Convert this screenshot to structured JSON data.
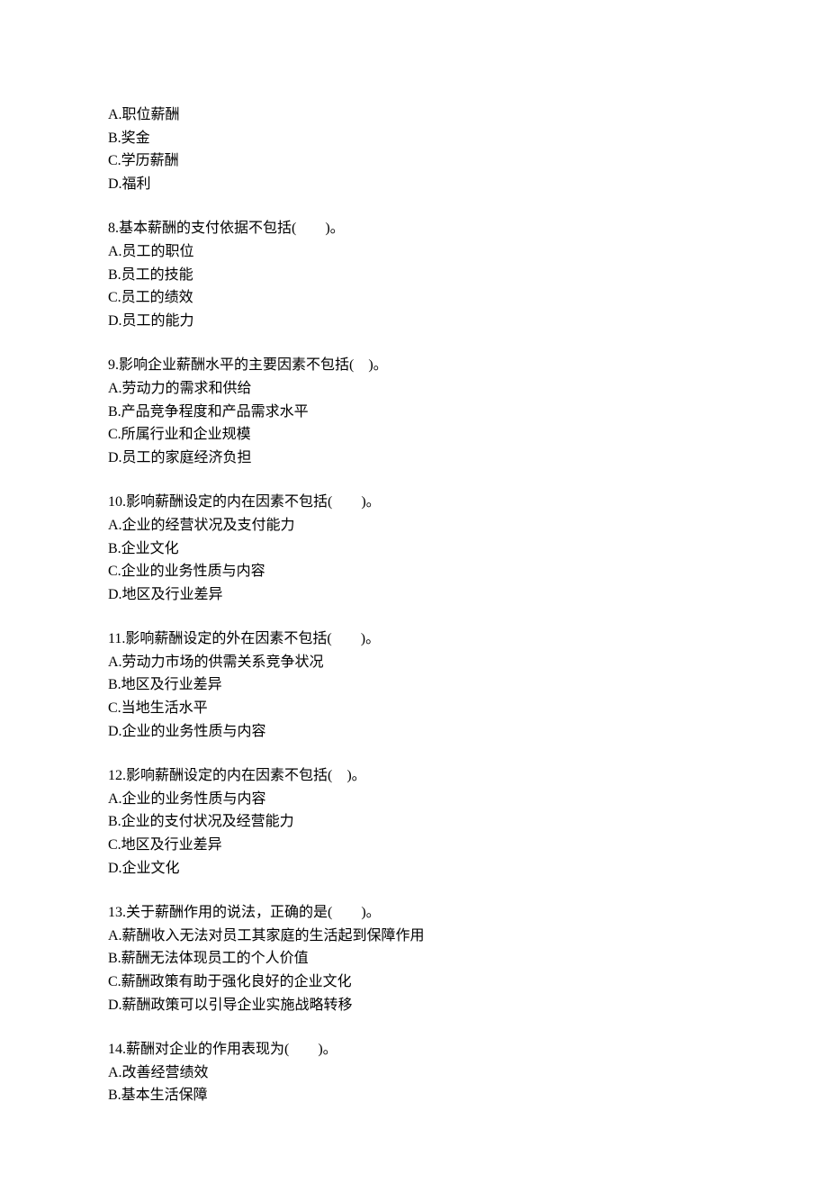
{
  "q7": {
    "options": {
      "A": "A.职位薪酬",
      "B": "B.奖金",
      "C": "C.学历薪酬",
      "D": "D.福利"
    }
  },
  "q8": {
    "stem": "8.基本薪酬的支付依据不包括(　　)。",
    "options": {
      "A": "A.员工的职位",
      "B": "B.员工的技能",
      "C": "C.员工的绩效",
      "D": "D.员工的能力"
    }
  },
  "q9": {
    "stem": "9.影响企业薪酬水平的主要因素不包括(　)。",
    "options": {
      "A": "A.劳动力的需求和供给",
      "B": "B.产品竞争程度和产品需求水平",
      "C": "C.所属行业和企业规模",
      "D": "D.员工的家庭经济负担"
    }
  },
  "q10": {
    "stem": "10.影响薪酬设定的内在因素不包括(　　)。",
    "options": {
      "A": "A.企业的经营状况及支付能力",
      "B": "B.企业文化",
      "C": "C.企业的业务性质与内容",
      "D": "D.地区及行业差异"
    }
  },
  "q11": {
    "stem": "11.影响薪酬设定的外在因素不包括(　　)。",
    "options": {
      "A": "A.劳动力市场的供需关系竞争状况",
      "B": "B.地区及行业差异",
      "C": "C.当地生活水平",
      "D": "D.企业的业务性质与内容"
    }
  },
  "q12": {
    "stem": "12.影响薪酬设定的内在因素不包括(　)。",
    "options": {
      "A": "A.企业的业务性质与内容",
      "B": "B.企业的支付状况及经营能力",
      "C": "C.地区及行业差异",
      "D": "D.企业文化"
    }
  },
  "q13": {
    "stem": "13.关于薪酬作用的说法，正确的是(　　)。",
    "options": {
      "A": "A.薪酬收入无法对员工其家庭的生活起到保障作用",
      "B": "B.薪酬无法体现员工的个人价值",
      "C": "C.薪酬政策有助于强化良好的企业文化",
      "D": "D.薪酬政策可以引导企业实施战略转移"
    }
  },
  "q14": {
    "stem": "14.薪酬对企业的作用表现为(　　)。",
    "options": {
      "A": "A.改善经营绩效",
      "B": "B.基本生活保障"
    }
  }
}
